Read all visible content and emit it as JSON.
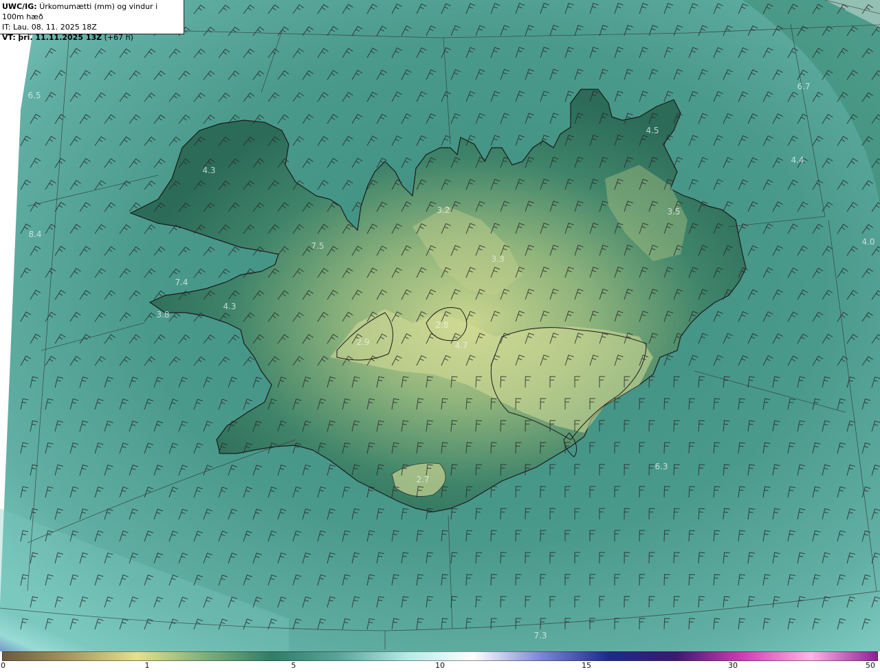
{
  "header": {
    "model_label": "UWC/IG:",
    "title": "Úrkomumætti (mm) og vindur i 100m hæð",
    "initial_time": "IT: Lau. 08. 11. 2025 18Z",
    "valid_label": "VT:",
    "valid_time": "þri. 11.11.2025 13Z",
    "lead_time": "(+67 h)"
  },
  "map_values": [
    {
      "text": "6.5"
    },
    {
      "text": "4.3"
    },
    {
      "text": "8.4"
    },
    {
      "text": "7.5"
    },
    {
      "text": "7.4"
    },
    {
      "text": "3.8"
    },
    {
      "text": "4.3"
    },
    {
      "text": "2.9"
    },
    {
      "text": "3.2"
    },
    {
      "text": "3.3"
    },
    {
      "text": "2.8"
    },
    {
      "text": "4.7"
    },
    {
      "text": "2.7"
    },
    {
      "text": "4.5"
    },
    {
      "text": "3.5"
    },
    {
      "text": "6.7"
    },
    {
      "text": "4.4"
    },
    {
      "text": "4.0"
    },
    {
      "text": "6.3"
    },
    {
      "text": "7.3"
    }
  ],
  "colorbar": {
    "ticks": [
      "0",
      "1",
      "5",
      "10",
      "15",
      "30",
      "50"
    ],
    "colors": [
      "#6b5a3c",
      "#a89660",
      "#e6e08c",
      "#7fb07a",
      "#2f7d66",
      "#5aa59a",
      "#b4ebe6",
      "#ffffff",
      "#7f86d6",
      "#1e2a8c",
      "#3a1a6e",
      "#d23cb4",
      "#ffb4e6",
      "#8c1e96"
    ]
  },
  "colors": {
    "sea": "#5aa59a",
    "land_low": "#2f6e5a",
    "land_high": "#c8d690",
    "coast": "#1a1a1a",
    "grid": "#333333"
  }
}
